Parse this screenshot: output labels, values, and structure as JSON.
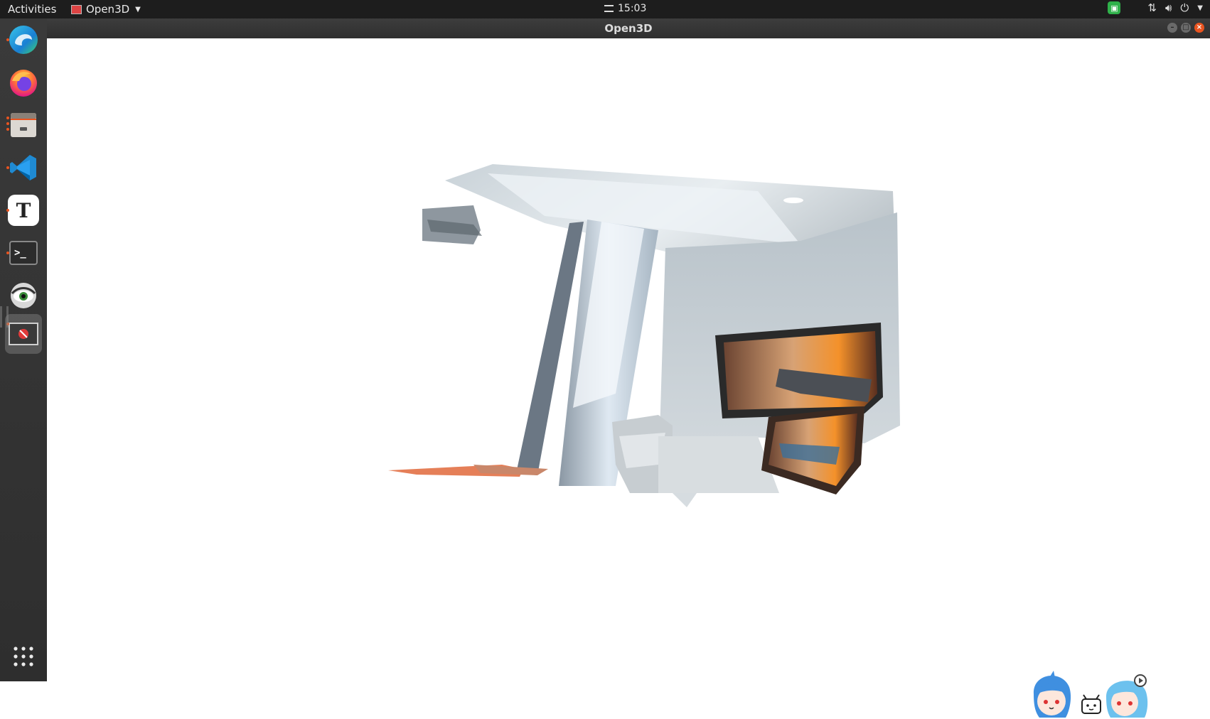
{
  "topbar": {
    "activities": "Activities",
    "app_menu": "Open3D",
    "clock": "15:03",
    "tray_icons": [
      "screen-share-icon",
      "network-icon",
      "volume-icon",
      "power-icon",
      "chevron-down-icon"
    ]
  },
  "dock": {
    "items": [
      {
        "name": "edge-icon",
        "label": "Microsoft Edge",
        "running": true
      },
      {
        "name": "firefox-icon",
        "label": "Firefox",
        "running": true
      },
      {
        "name": "files-icon",
        "label": "Files",
        "running": true
      },
      {
        "name": "vscode-icon",
        "label": "Visual Studio Code",
        "running": true
      },
      {
        "name": "typora-icon",
        "label": "Typora",
        "running": true
      },
      {
        "name": "terminal-icon",
        "label": "Terminal",
        "running": true
      },
      {
        "name": "eye-app-icon",
        "label": "Viewer",
        "running": false
      },
      {
        "name": "open3d-window-icon",
        "label": "Open3D",
        "running": true,
        "active": true
      }
    ],
    "show_apps": "show-apps-icon"
  },
  "window": {
    "title": "Open3D",
    "controls": [
      "minimize",
      "maximize",
      "close"
    ]
  },
  "colors": {
    "accent": "#e95420",
    "topbar_bg": "#1d1d1d",
    "dock_bg": "#333333",
    "canvas_bg": "#ffffff"
  }
}
